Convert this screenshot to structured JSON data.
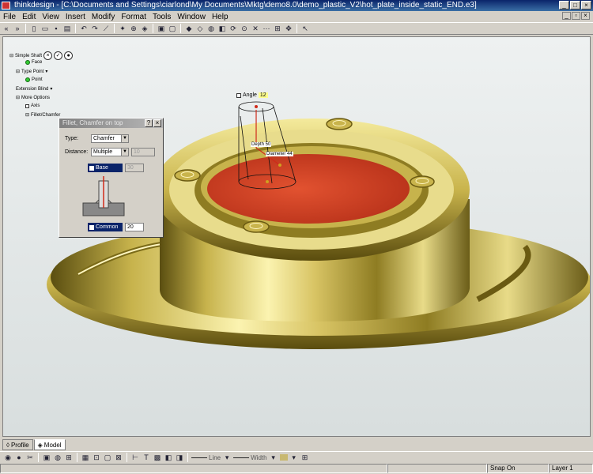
{
  "window": {
    "title": "thinkdesign - [C:\\Documents and Settings\\ciarlond\\My Documents\\Mktg\\demo8.0\\demo_plastic_V2\\hot_plate_inside_static_END.e3]",
    "min": "_",
    "max": "□",
    "close": "×"
  },
  "menu": [
    "File",
    "Edit",
    "View",
    "Insert",
    "Modify",
    "Format",
    "Tools",
    "Window",
    "Help"
  ],
  "tree": {
    "root": "Simple Shaft",
    "face": "Face",
    "type_point": "Type Point",
    "point": "Point",
    "extension": "Extension Blind",
    "more_options": "More Options",
    "axis": "Axis",
    "fillet": "Fillet/Chamfer"
  },
  "dialog": {
    "title": "Fillet, Chamfer on top",
    "type_label": "Type:",
    "type_value": "Chamfer",
    "distance_label": "Distance:",
    "distance_value": "Multiple",
    "distance_num": "10",
    "base_label": "Base",
    "base_value": "30",
    "common_label": "Common",
    "common_value": "20",
    "help": "?",
    "close": "×"
  },
  "annotations": {
    "angle_label": "Angle",
    "angle_value": "12",
    "depth": "Depth 50",
    "diameter": "Diameter 44"
  },
  "tabs": {
    "profile": "Profile",
    "model": "Model"
  },
  "toolbar2": {
    "line": "Line",
    "width": "Width"
  },
  "status": {
    "snap": "Snap On",
    "layer": "Layer 1"
  },
  "colors": {
    "accent": "#0a246a",
    "gold": "#d8c66a",
    "red": "#d03a1c"
  }
}
